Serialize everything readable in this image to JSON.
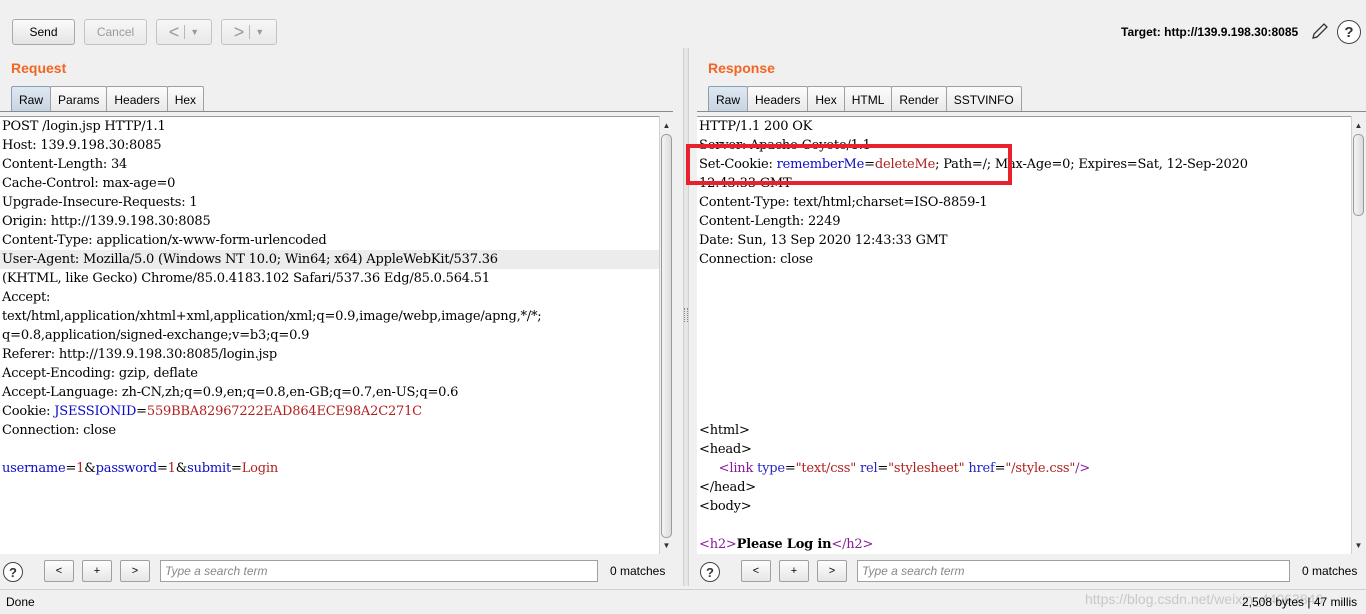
{
  "toolbar": {
    "send_label": "Send",
    "cancel_label": "Cancel",
    "back_glyph": "<",
    "forward_glyph": ">",
    "dropdown_glyph": "▼",
    "target_label": "Target: http://139.9.198.30:8085",
    "edit_icon": "pencil-icon",
    "help_icon": "help-icon",
    "help_glyph": "?"
  },
  "request": {
    "title": "Request",
    "tabs": [
      "Raw",
      "Params",
      "Headers",
      "Hex"
    ],
    "active_tab": "Raw",
    "lines": [
      "POST /login.jsp HTTP/1.1",
      "Host: 139.9.198.30:8085",
      "Content-Length: 34",
      "Cache-Control: max-age=0",
      "Upgrade-Insecure-Requests: 1",
      "Origin: http://139.9.198.30:8085",
      "Content-Type: application/x-www-form-urlencoded",
      "User-Agent: Mozilla/5.0 (Windows NT 10.0; Win64; x64) AppleWebKit/537.36",
      "(KHTML, like Gecko) Chrome/85.0.4183.102 Safari/537.36 Edg/85.0.564.51",
      "Accept:",
      "text/html,application/xhtml+xml,application/xml;q=0.9,image/webp,image/apng,*/*;",
      "q=0.8,application/signed-exchange;v=b3;q=0.9",
      "Referer: http://139.9.198.30:8085/login.jsp",
      "Accept-Encoding: gzip, deflate",
      "Accept-Language: zh-CN,zh;q=0.9,en;q=0.8,en-GB;q=0.7,en-US;q=0.6"
    ],
    "cookie_prefix": "Cookie: ",
    "cookie_key": "JSESSIONID",
    "cookie_eq": "=",
    "cookie_value": "559BBA82967222EAD864ECE98A2C271C",
    "connection_line": "Connection: close",
    "body": {
      "k1": "username",
      "v1": "1",
      "k2": "password",
      "v2": "1",
      "k3": "submit",
      "v3": "Login",
      "eq": "=",
      "amp": "&"
    },
    "search_placeholder": "Type a search term",
    "matches": "0 matches",
    "nav": {
      "prev": "<",
      "add": "+",
      "next": ">"
    }
  },
  "response": {
    "title": "Response",
    "tabs": [
      "Raw",
      "Headers",
      "Hex",
      "HTML",
      "Render",
      "SSTVINFO"
    ],
    "active_tab": "Raw",
    "status_line": "HTTP/1.1 200 OK",
    "server_line": "Server: Apache-Coyote/1.1",
    "setcookie_prefix": "Set-Cookie: ",
    "setcookie_key": "rememberMe",
    "setcookie_eq": "=",
    "setcookie_value": "deleteMe",
    "setcookie_rest": "; Path=/; Max-Age=0; Expires=Sat, 12-Sep-2020",
    "setcookie_cont": "12:43:33 GMT",
    "headers": [
      "Content-Type: text/html;charset=ISO-8859-1",
      "Content-Length: 2249",
      "Date: Sun, 13 Sep 2020 12:43:33 GMT",
      "Connection: close"
    ],
    "html_lines": {
      "html_open": "<html>",
      "head_open": "<head>",
      "link_tag_open": "<link",
      "link_attr1": "type",
      "link_val1": "\"text/css\"",
      "link_attr2": "rel",
      "link_val2": "\"stylesheet\"",
      "link_attr3": "href",
      "link_val3": "\"/style.css\"",
      "link_close": "/>",
      "head_close": "</head>",
      "body_open": "<body>",
      "h2_open": "<h2>",
      "h2_text": "Please Log in",
      "h2_close": "</h2>"
    },
    "search_placeholder": "Type a search term",
    "matches": "0 matches",
    "nav": {
      "prev": "<",
      "add": "+",
      "next": ">"
    }
  },
  "status_bar": {
    "left": "Done",
    "right": "2,508 bytes | 47 millis",
    "watermark": "https://blog.csdn.net/weixin_44063846"
  },
  "colors": {
    "section_title": "#f26522",
    "highlight_box": "#e8222a",
    "param_key": "#0a0ac8",
    "param_value": "#b0201e"
  }
}
